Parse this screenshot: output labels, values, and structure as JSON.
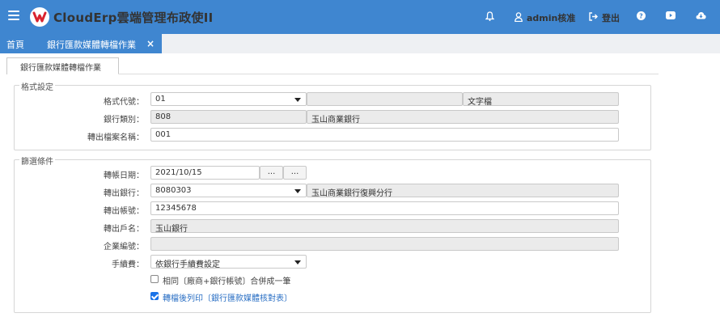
{
  "header": {
    "app_title": "CloudErp雲端管理布政使II",
    "user": "admin核准",
    "logout": "登出",
    "icons": [
      "hamburger-icon",
      "logo-icon",
      "bell-icon",
      "user-icon",
      "logout-icon",
      "help-icon",
      "youtube-icon",
      "cloud-download-icon"
    ]
  },
  "tabs": {
    "home": "首頁",
    "active": "銀行匯款媒體轉檔作業",
    "close": "×"
  },
  "inner_tab": "銀行匯款媒體轉檔作業",
  "format_section": {
    "legend": "格式設定",
    "format_code_label": "格式代號：",
    "format_code_value": "01",
    "format_name_value": "",
    "format_type_value": "文字檔",
    "bank_type_label": "銀行類別：",
    "bank_type_code": "808",
    "bank_type_name": "玉山商業銀行",
    "output_file_label": "轉出檔案名稱：",
    "output_file_value": "001"
  },
  "filter_section": {
    "legend": "篩選條件",
    "transfer_date_label": "轉帳日期：",
    "transfer_date_value": "2021/10/15",
    "ellipsis1": "...",
    "ellipsis2": "...",
    "out_bank_label": "轉出銀行：",
    "out_bank_code": "8080303",
    "out_bank_name": "玉山商業銀行復興分行",
    "out_account_label": "轉出帳號：",
    "out_account_value": "12345678",
    "out_holder_label": "轉出戶名：",
    "out_holder_value": "玉山銀行",
    "company_no_label": "企業編號：",
    "company_no_value": "",
    "fee_label": "手續費：",
    "fee_value": "依銀行手續費設定",
    "merge_label": "相同〔廠商+銀行帳號〕合併成一筆",
    "merge_checked": false,
    "print_label": "轉檔後列印〔銀行匯款媒體核對表〕",
    "print_checked": true
  },
  "colors": {
    "header_blue": "#3f86d0",
    "checkbox_blue": "#1a73e8",
    "link_blue": "#2a6fc4"
  }
}
